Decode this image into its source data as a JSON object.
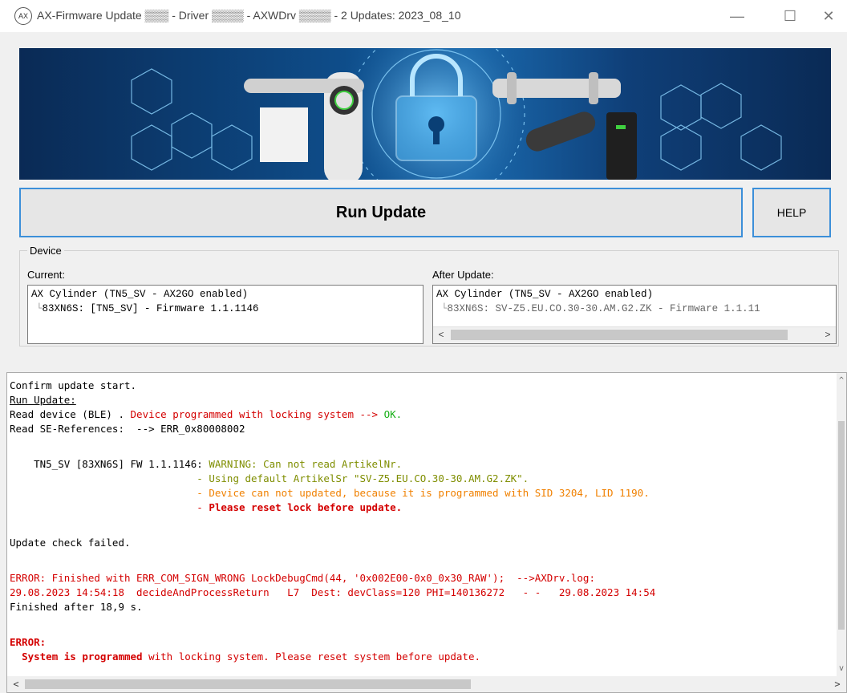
{
  "window": {
    "app_icon_text": "AX",
    "title": "AX-Firmware Update ▒▒▒ - Driver ▒▒▒▒ - AXWDrv ▒▒▒▒ -  2 Updates: 2023_08_10",
    "controls": {
      "minimize": "—",
      "maximize": "☐",
      "close": "✕"
    }
  },
  "toolbar": {
    "run_update_label": "Run Update",
    "help_label": "HELP"
  },
  "device": {
    "group_title": "Device",
    "current_label": "Current:",
    "after_label": "After Update:",
    "current_tree": {
      "root": "AX Cylinder (TN5_SV - AX2GO enabled)",
      "child": "83XN6S: [TN5_SV] - Firmware 1.1.1146"
    },
    "after_tree": {
      "root": "AX Cylinder (TN5_SV - AX2GO enabled)",
      "child": "83XN6S: SV-Z5.EU.CO.30-30.AM.G2.ZK - Firmware 1.1.11"
    }
  },
  "log": {
    "l1": "Confirm update start.",
    "l2": "Run Update:",
    "l3a": "Read device (BLE) . ",
    "l3b": "Device programmed with locking system --> ",
    "l3c": "OK.",
    "l4": "Read SE-References:  --> ERR_0x80008002",
    "l5a": "    TN5_SV [83XN6S] FW 1.1.1146: ",
    "l5b": "WARNING: Can not read ArtikelNr.",
    "l6": "                               - Using default ArtikelSr \"SV-Z5.EU.CO.30-30.AM.G2.ZK\".",
    "l7": "                               - Device can not updated, because it is programmed with SID 3204, LID 1190.",
    "l8a": "                               - ",
    "l8b": "Please reset lock before update.",
    "l9": "Update check failed.",
    "l10": "ERROR: Finished with ERR_COM_SIGN_WRONG LockDebugCmd(44, '0x002E00-0x0_0x30_RAW');  -->AXDrv.log:",
    "l11": "29.08.2023 14:54:18  decideAndProcessReturn   L7  Dest: devClass=120 PHI=140136272   - -   29.08.2023 14:54",
    "l12": "Finished after 18,9 s.",
    "l13": "ERROR:",
    "l14a": "  ",
    "l14b": "System is programmed",
    "l14c": " with locking system. Please reset system before update."
  }
}
